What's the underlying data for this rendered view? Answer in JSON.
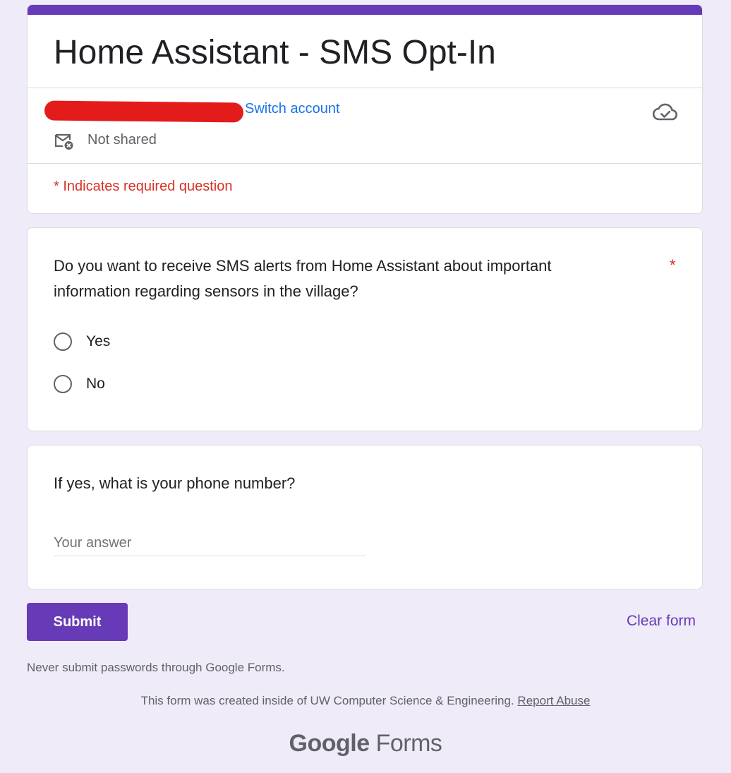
{
  "form": {
    "title": "Home Assistant - SMS Opt-In",
    "accent_color": "#673ab7",
    "background_color": "#f0ebf8"
  },
  "account": {
    "switch_label": "Switch account",
    "not_shared_label": "Not shared",
    "cloud_icon": "cloud-check-icon",
    "mail_icon": "mail-not-shared-icon"
  },
  "required_note": "* Indicates required question",
  "questions": [
    {
      "text": "Do you want to receive SMS alerts from Home Assistant about important information regarding sensors in the village?",
      "required_marker": "*",
      "options": [
        "Yes",
        "No"
      ]
    },
    {
      "text": "If yes, what is your phone number?",
      "placeholder": "Your answer"
    }
  ],
  "actions": {
    "submit_label": "Submit",
    "clear_label": "Clear form"
  },
  "footer": {
    "warning": "Never submit passwords through Google Forms.",
    "created_text": "This form was created inside of UW Computer Science & Engineering.",
    "report_label": "Report Abuse",
    "logo_google": "Google",
    "logo_forms": "Forms"
  }
}
